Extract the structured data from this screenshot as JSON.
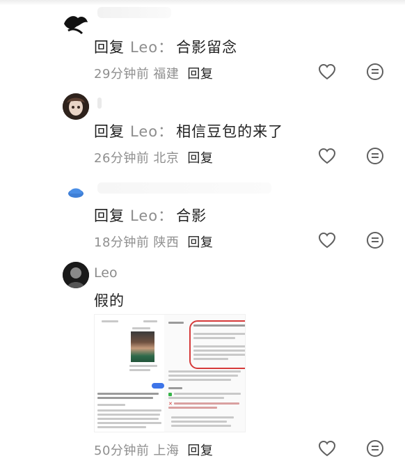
{
  "comments": [
    {
      "username": "",
      "reply_label": "回复",
      "reply_to": "Leo",
      "colon": "：",
      "text": "合影留念",
      "time": "29分钟前",
      "location": "福建",
      "reply_button": "回复"
    },
    {
      "username": "",
      "reply_label": "回复",
      "reply_to": "Leo",
      "colon": "：",
      "text": "相信豆包的来了",
      "time": "26分钟前",
      "location": "北京",
      "reply_button": "回复"
    },
    {
      "username": "",
      "reply_label": "回复",
      "reply_to": "Leo",
      "colon": "：",
      "text": "合影",
      "time": "18分钟前",
      "location": "陕西",
      "reply_button": "回复"
    },
    {
      "username": "Leo",
      "text": "假的",
      "time": "50分钟前",
      "location": "上海",
      "reply_button": "回复"
    }
  ],
  "icons": {
    "like": "heart-outline-icon",
    "more": "ellipsis-circle-icon"
  },
  "colors": {
    "secondary_text": "#8f8f8f",
    "primary_text": "#1f1f1f",
    "highlight_box": "#d63a3a",
    "button_blue": "#3d74e8"
  }
}
